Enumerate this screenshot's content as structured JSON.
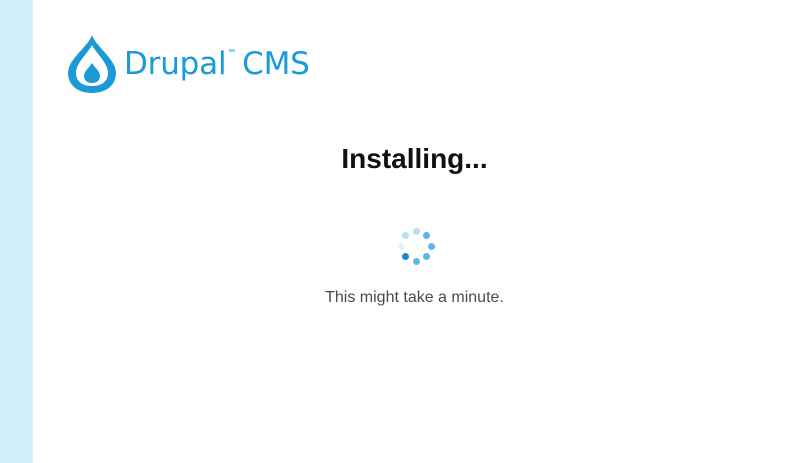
{
  "brand": {
    "name": "Drupal",
    "trademark": "™",
    "product": "CMS",
    "logo_icon": "drupal-drop-icon",
    "color": "#1a9ad6"
  },
  "install": {
    "title": "Installing...",
    "message": "This might take a minute.",
    "spinner_icon": "loading-spinner-icon"
  },
  "colors": {
    "side_strip": "#d3eefb",
    "spinner_dark": "#1f87c9",
    "spinner_mid": "#5fb5e3",
    "spinner_light": "#b9ddf2",
    "spinner_faint": "#e3f1fa"
  }
}
